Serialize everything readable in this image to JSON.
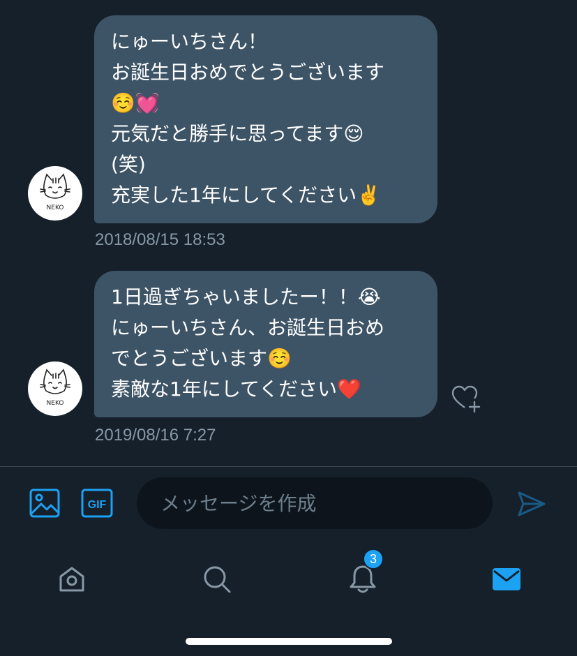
{
  "messages": [
    {
      "avatar_text": "NEKO",
      "lines": [
        "にゅーいちさん！",
        "お誕生日おめでとうございます",
        "☺️💓",
        "元気だと勝手に思ってます😌",
        "(笑)",
        "充実した1年にしてください✌️"
      ],
      "timestamp": "2018/08/15 18:53"
    },
    {
      "avatar_text": "NEKO",
      "lines": [
        "1日過ぎちゃいましたー！！😭",
        "にゅーいちさん、お誕生日おめ",
        "でとうございます☺️",
        "素敵な1年にしてください❤️"
      ],
      "timestamp": "2019/08/16 7:27"
    }
  ],
  "composer": {
    "placeholder": "メッセージを作成",
    "gif_label": "GIF",
    "image_icon": "image-icon",
    "send_icon": "send-icon"
  },
  "tabbar": {
    "items": [
      {
        "name": "home",
        "icon": "home-icon"
      },
      {
        "name": "search",
        "icon": "search-icon"
      },
      {
        "name": "notifications",
        "icon": "bell-icon",
        "badge": "3"
      },
      {
        "name": "messages",
        "icon": "mail-icon",
        "active": true
      }
    ]
  },
  "colors": {
    "background": "#15202b",
    "bubble": "#3d5466",
    "accent": "#1da1f2",
    "muted": "#8899a6",
    "heart": "#e0245e"
  }
}
